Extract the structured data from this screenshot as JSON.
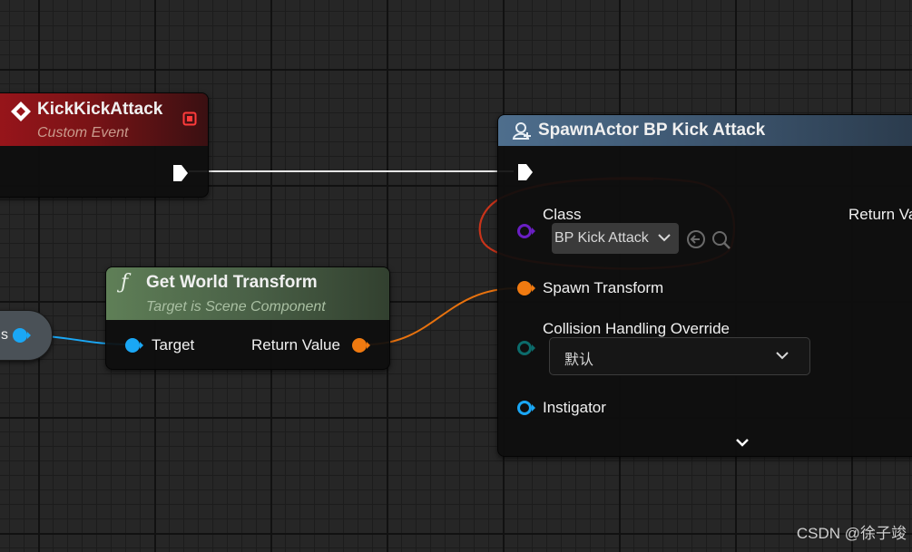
{
  "window": {
    "watermark": "CSDN @徐子竣"
  },
  "event_node": {
    "title": "KickKickAttack",
    "subtitle": "Custom Event",
    "color": "#9a151b"
  },
  "get_world_transform": {
    "title": "Get World Transform",
    "subtitle": "Target is Scene Component",
    "target_label": "Target",
    "return_label": "Return Value",
    "color": "#5f7f57"
  },
  "variable_node": {
    "label": "s"
  },
  "spawn_node": {
    "title": "SpawnActor BP Kick Attack",
    "class_label": "Class",
    "class_value": "BP Kick Attack",
    "return_label": "Return Va",
    "spawn_transform_label": "Spawn Transform",
    "collision_label": "Collision Handling Override",
    "collision_value": "默认",
    "instigator_label": "Instigator",
    "color": "#4e6e8d"
  },
  "colors": {
    "exec_wire": "#e6e6e6",
    "transform_pin": "#f07a10",
    "object_pin": "#1aa7f5",
    "class_pin": "#6a1fc4",
    "byte_pin": "#0c6b6b",
    "annotation": "#c8331a"
  },
  "icons": {
    "event": "event-diamond-icon",
    "function": "function-f-icon",
    "spawn": "spawn-actor-icon",
    "use_selected": "use-selected-arrow-icon",
    "browse": "magnifier-icon",
    "dropdown": "chevron-down-icon",
    "expand": "chevron-down-icon"
  }
}
